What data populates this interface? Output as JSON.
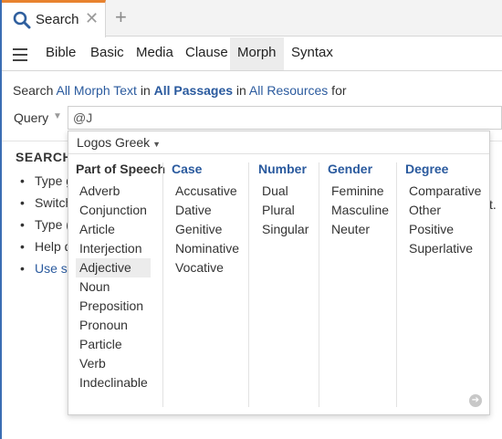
{
  "tab": {
    "label": "Search",
    "close": "✕",
    "add": "+"
  },
  "nav": {
    "tabs": [
      {
        "label": "Bible"
      },
      {
        "label": "Basic"
      },
      {
        "label": "Media"
      },
      {
        "label": "Clause"
      },
      {
        "label": "Morph"
      },
      {
        "label": "Syntax"
      }
    ],
    "active": "Morph"
  },
  "scope": {
    "p1": "Search ",
    "l1": "All Morph Text",
    "p2": " in ",
    "l2": "All Passages",
    "p3": " in ",
    "l3": "All Resources",
    "p4": " for"
  },
  "query": {
    "label": "Query",
    "value": "@J"
  },
  "body": {
    "heading": "SEARCH",
    "items": [
      "Type g",
      "Switch",
      "Type (",
      "Help d",
      "Use se"
    ],
    "tail": "t."
  },
  "dropdown": {
    "language": "Logos Greek",
    "columns": [
      {
        "heading": "Part of Speech",
        "items": [
          "Adverb",
          "Conjunction",
          "Article",
          "Interjection",
          "Adjective",
          "Noun",
          "Preposition",
          "Pronoun",
          "Particle",
          "Verb",
          "Indeclinable"
        ]
      },
      {
        "heading": "Case",
        "items": [
          "Accusative",
          "Dative",
          "Genitive",
          "Nominative",
          "Vocative"
        ]
      },
      {
        "heading": "Number",
        "items": [
          "Dual",
          "Plural",
          "Singular"
        ]
      },
      {
        "heading": "Gender",
        "items": [
          "Feminine",
          "Masculine",
          "Neuter"
        ]
      },
      {
        "heading": "Degree",
        "items": [
          "Comparative",
          "Other",
          "Positive",
          "Superlative"
        ]
      }
    ],
    "highlighted": "Adjective"
  },
  "colors": {
    "accent": "#e8832f",
    "link": "#2a5a9e"
  }
}
